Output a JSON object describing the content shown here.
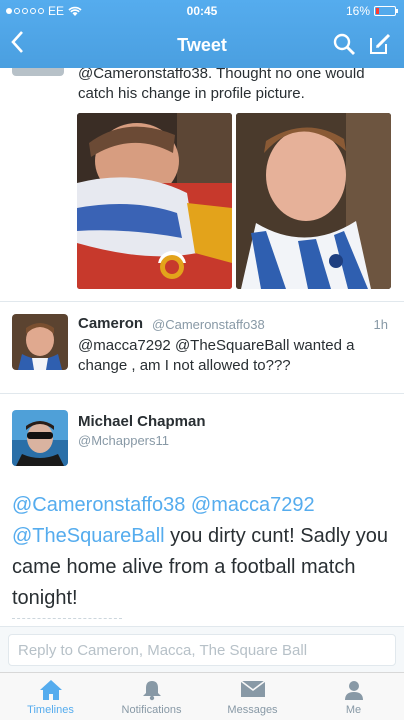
{
  "status_bar": {
    "carrier": "EE",
    "time": "00:45",
    "battery": "16%",
    "battery_level": 0.16
  },
  "nav": {
    "title": "Tweet"
  },
  "main_tweet": {
    "text": "@Cameronstaffo38. Thought no one would catch his change in profile picture."
  },
  "reply_tweet": {
    "name": "Cameron",
    "handle": "@Cameronstaffo38",
    "time": "1h",
    "mention1": "@macca7292",
    "mention2": "@TheSquareBall",
    "text": " wanted a change , am I not allowed to???"
  },
  "focus_tweet": {
    "name": "Michael Chapman",
    "handle": "@Mchappers11",
    "mention1": "@Cameronstaffo38",
    "mention2": "@macca7292",
    "mention3": "@TheSquareBall",
    "text": " you dirty cunt! Sadly you came home alive from a football match tonight!"
  },
  "reply_bar": {
    "placeholder": "Reply to Cameron, Macca, The Square Ball"
  },
  "tabs": [
    {
      "label": "Timelines",
      "icon": "home-icon",
      "active": true
    },
    {
      "label": "Notifications",
      "icon": "bell-icon",
      "active": false
    },
    {
      "label": "Messages",
      "icon": "envelope-icon",
      "active": false
    },
    {
      "label": "Me",
      "icon": "person-icon",
      "active": false
    }
  ],
  "colors": {
    "accent": "#55acee",
    "text": "#292f33",
    "muted": "#8899a6"
  }
}
